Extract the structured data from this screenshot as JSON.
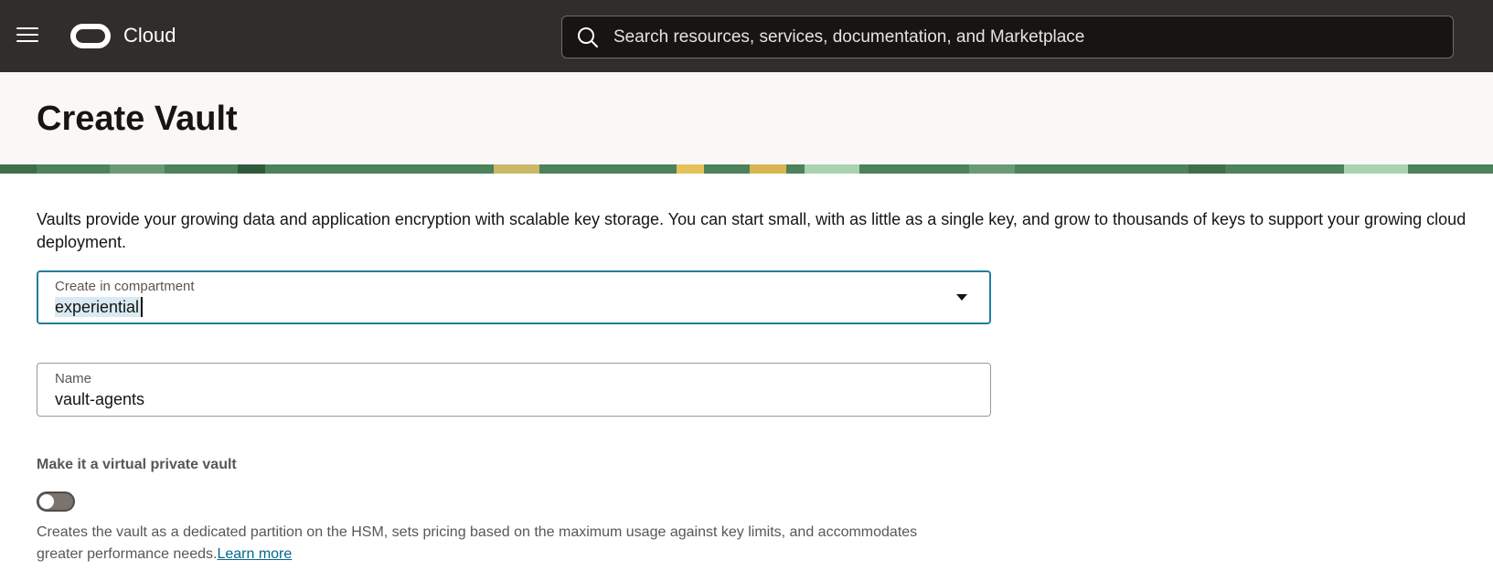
{
  "topbar": {
    "brand": "Cloud",
    "search_placeholder": "Search resources, services, documentation, and Marketplace"
  },
  "header": {
    "title": "Create Vault"
  },
  "intro": {
    "text": "Vaults provide your growing data and application encryption with scalable key storage. You can start small, with as little as a single key, and grow to thousands of keys to support your growing cloud deployment."
  },
  "form": {
    "compartment": {
      "label": "Create in compartment",
      "value": "experiential"
    },
    "name": {
      "label": "Name",
      "value": "vault-agents"
    },
    "virtual_private_vault": {
      "label": "Make it a virtual private vault",
      "enabled": false,
      "help_text": "Creates the vault as a dedicated partition on the HSM, sets pricing based on the maximum usage against key limits, and accommodates greater performance needs.",
      "learn_more": "Learn more"
    }
  },
  "colors": {
    "topbar_bg": "#312d2a",
    "header_bg": "#f9f8f6",
    "focus_border": "#227e9e",
    "link": "#00688c",
    "banner_green": "#4c825c"
  }
}
